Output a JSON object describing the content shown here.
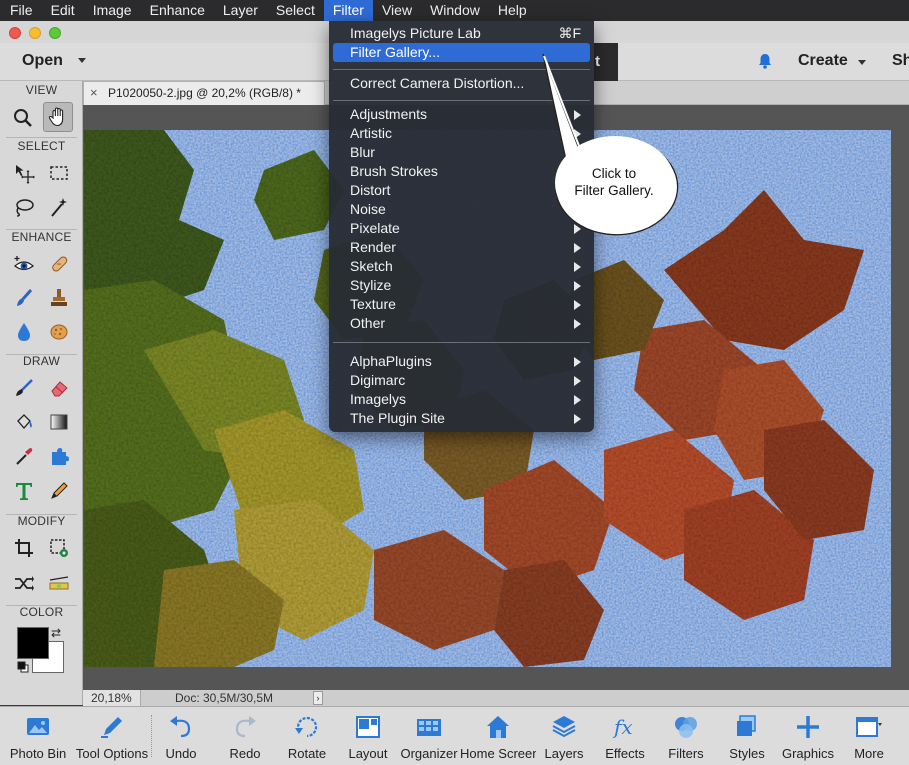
{
  "menubar": {
    "items": [
      "File",
      "Edit",
      "Image",
      "Enhance",
      "Layer",
      "Select",
      "Filter",
      "View",
      "Window",
      "Help"
    ],
    "active": "Filter"
  },
  "topbar": {
    "open_label": "Open",
    "partial_tab_char": "t",
    "create_label": "Create",
    "share_partial": "Sh"
  },
  "toolbox": {
    "sections": {
      "view": "VIEW",
      "select": "SELECT",
      "enhance": "ENHANCE",
      "draw": "DRAW",
      "modify": "MODIFY",
      "color": "COLOR"
    },
    "colors": {
      "foreground": "#000000",
      "background": "#ffffff"
    }
  },
  "document": {
    "tab_title": "P1020050-2.jpg @ 20,2% (RGB/8) *",
    "close_glyph": "×"
  },
  "status": {
    "zoom": "20,18%",
    "doc_size": "Doc: 30,5M/30,5M",
    "arrow": "›"
  },
  "filter_menu": {
    "top_items": [
      {
        "label": "Imagelys Picture Lab",
        "shortcut": "⌘F"
      },
      {
        "label": "Filter Gallery...",
        "highlighted": true
      }
    ],
    "camera_item": "Correct Camera Distortion...",
    "categories": [
      "Adjustments",
      "Artistic",
      "Blur",
      "Brush Strokes",
      "Distort",
      "Noise",
      "Pixelate",
      "Render",
      "Sketch",
      "Stylize",
      "Texture",
      "Other"
    ],
    "categories_with_submenu": [
      true,
      true,
      false,
      false,
      false,
      false,
      true,
      true,
      true,
      true,
      true,
      true
    ],
    "plugins": [
      "AlphaPlugins",
      "Digimarc",
      "Imagelys",
      "The Plugin Site"
    ]
  },
  "callout": {
    "line1": "Click to",
    "line2": "Filter Gallery."
  },
  "taskbar": {
    "items": [
      "Photo Bin",
      "Tool Options",
      "Undo",
      "Redo",
      "Rotate",
      "Layout",
      "Organizer",
      "Home Screen",
      "Layers",
      "Effects",
      "Filters",
      "Styles",
      "Graphics",
      "More"
    ]
  },
  "colors": {
    "accent": "#2f6bd4",
    "menu_bg": "#282c34",
    "sky": "#5d8fd2"
  }
}
